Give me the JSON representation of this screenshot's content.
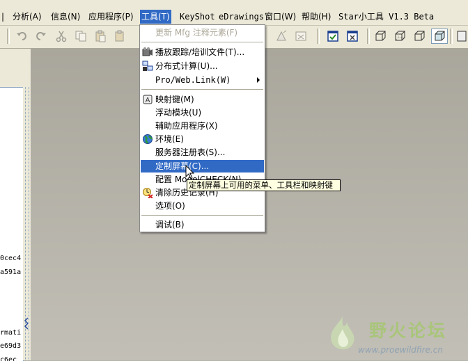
{
  "menubar": {
    "items": [
      {
        "id": "analysis",
        "label": "分析(A)"
      },
      {
        "id": "info",
        "label": "信息(N)"
      },
      {
        "id": "apps",
        "label": "应用程序(P)"
      },
      {
        "id": "tools",
        "label": "工具(T)"
      },
      {
        "id": "keyshot",
        "label": "KeyShot"
      },
      {
        "id": "edrawings",
        "label": "eDrawings"
      },
      {
        "id": "window",
        "label": "窗口(W)"
      },
      {
        "id": "help",
        "label": "帮助(H)"
      },
      {
        "id": "star",
        "label": "Star小工具 V1.3 Beta"
      }
    ]
  },
  "tools_menu": {
    "items": [
      {
        "label": "更新 Mfg 注释元素(F)",
        "disabled": true,
        "icon": ""
      },
      {
        "label": "播放跟踪/培训文件(T)...",
        "icon": "trail-playback-icon"
      },
      {
        "label": "分布式计算(U)...",
        "icon": "distributed-computing-icon"
      },
      {
        "label": "Pro/Web.Link(W)",
        "icon": "",
        "submenu": true
      },
      {
        "label": "映射键(M)",
        "icon": "mapkey-icon"
      },
      {
        "label": "浮动模块(U)",
        "icon": ""
      },
      {
        "label": "辅助应用程序(X)",
        "icon": ""
      },
      {
        "label": "环境(E)",
        "icon": "environment-icon"
      },
      {
        "label": "服务器注册表(S)...",
        "icon": ""
      },
      {
        "label": "定制屏幕(C)...",
        "icon": "",
        "highlighted": true
      },
      {
        "label": "配置 ModelCHECK(N)",
        "icon": ""
      },
      {
        "label": "清除历史记录(H)",
        "icon": "clear-history-icon"
      },
      {
        "label": "选项(O)",
        "icon": ""
      },
      {
        "label": "调试(B)",
        "icon": ""
      }
    ]
  },
  "tooltip": {
    "text": "定制屏幕上可用的菜单、工具栏和映射键"
  },
  "tree": {
    "lines": [
      "0cec4",
      "a591a",
      "rmati",
      "e69d3",
      "c6ec"
    ]
  },
  "watermark": {
    "title": "野火论坛",
    "url": "www.proewildfire.cn"
  },
  "colors": {
    "highlight": "#316ac5",
    "menu_bg": "#ece9d8",
    "graphics_bg": "#b6b3aa"
  }
}
